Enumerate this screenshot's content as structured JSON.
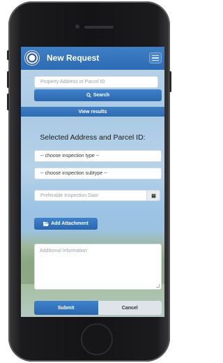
{
  "navbar": {
    "title": "New Request",
    "logo_icon": "seal-logo-icon",
    "menu_icon": "hamburger-menu-icon",
    "color": "#2d6bb2"
  },
  "search": {
    "placeholder": "Property Address or Parcel ID",
    "button_label": "Search",
    "button_icon": "search-icon"
  },
  "results_band": {
    "label": "View results"
  },
  "form": {
    "section_title": "Selected Address and Parcel ID:",
    "inspection_type": "-- choose inspection type --",
    "inspection_subtype": "-- choose inspection subtype --",
    "date_placeholder": "Preferable Inspection Date",
    "date_icon": "calendar-icon",
    "attachment_label": "Add Attachment",
    "attachment_icon": "folder-open-icon",
    "additional_info_placeholder": "Additional Information"
  },
  "footer": {
    "submit_label": "Submit",
    "cancel_label": "Cancel"
  }
}
